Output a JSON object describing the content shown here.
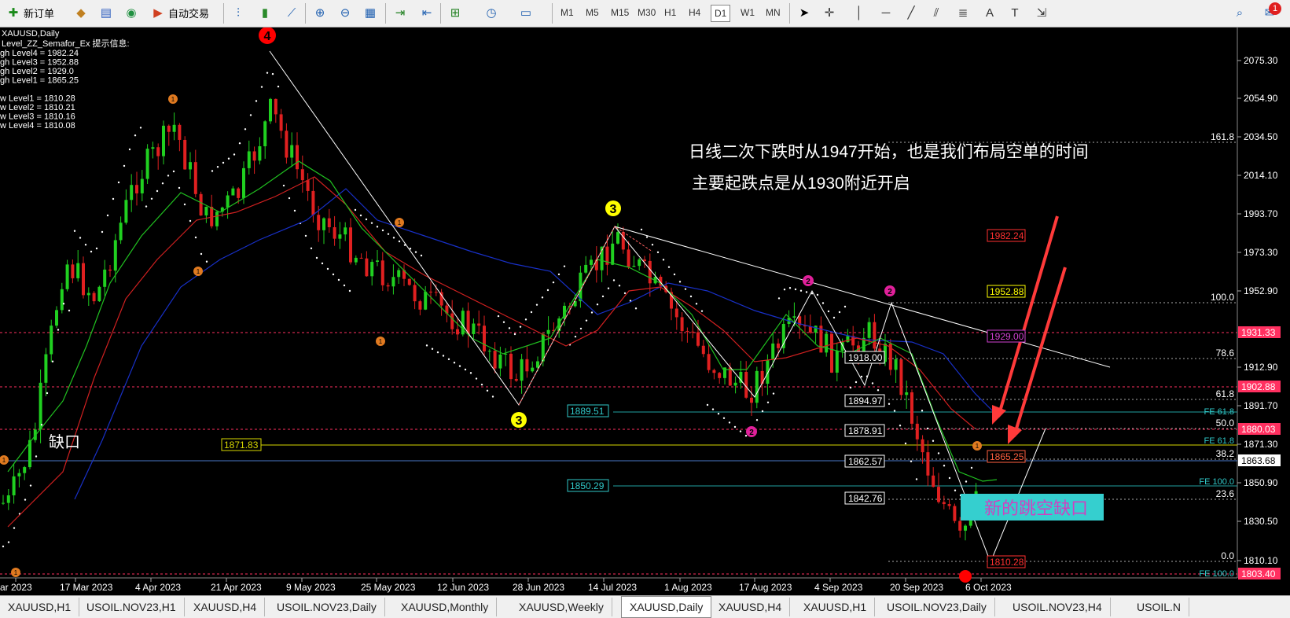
{
  "toolbar": {
    "new_order": "新订单",
    "autotrade": "自动交易",
    "timeframes": [
      "M1",
      "M5",
      "M15",
      "M30",
      "H1",
      "H4",
      "D1",
      "W1",
      "MN"
    ],
    "active_timeframe": "D1",
    "notification_count": "1"
  },
  "chart": {
    "symbol_line": "XAUUSD,Daily",
    "indicator_title": "Level_ZZ_Semafor_Ex 提示信息:",
    "levels_text": [
      "gh Level4 = 1982.24",
      "gh Level3 = 1952.88",
      "gh Level2 = 1929.0",
      "gh Level1 = 1865.25",
      "",
      "w Level1 = 1810.28",
      "w Level2 = 1810.21",
      "w Level3 = 1810.16",
      "w Level4 = 1810.08"
    ],
    "annotation_1": "日线二次下跌时从1947开始，也是我们布局空单的时间",
    "annotation_2": "主要起跌点是从1930附近开启",
    "gap_label": "缺口",
    "new_gap_label": "新的跳空缺口",
    "y_ticks": [
      "2075.30",
      "2054.90",
      "2034.50",
      "2014.10",
      "1993.70",
      "1973.30",
      "1952.90",
      "1912.90",
      "1891.70",
      "1871.30",
      "1850.90",
      "1830.50",
      "1810.10"
    ],
    "price_tags": [
      {
        "text": "1931.33",
        "color": "#ff3060"
      },
      {
        "text": "1902.88",
        "color": "#ff3060"
      },
      {
        "text": "1880.03",
        "color": "#ff3060"
      },
      {
        "text": "1863.68",
        "color": "#ffffff"
      },
      {
        "text": "1803.40",
        "color": "#ff3060"
      }
    ],
    "fib_labels": [
      "161.8",
      "100.0",
      "78.6",
      "61.8",
      "50.0",
      "38.2",
      "23.6",
      "0.0"
    ],
    "fe_labels": [
      "FE 61.8",
      "FE 61.8",
      "FE 100.0",
      "FE 100.0"
    ],
    "x_ticks": [
      "ar 2023",
      "17 Mar 2023",
      "4 Apr 2023",
      "21 Apr 2023",
      "9 May 2023",
      "25 May 2023",
      "12 Jun 2023",
      "28 Jun 2023",
      "14 Jul 2023",
      "1 Aug 2023",
      "17 Aug 2023",
      "4 Sep 2023",
      "20 Sep 2023",
      "6 Oct 2023"
    ],
    "boxed_prices": [
      "1918.00",
      "1894.97",
      "1878.91",
      "1862.57",
      "1842.76"
    ],
    "cyan_boxes": [
      "1889.51",
      "1850.29"
    ],
    "yellow_box": "1871.83",
    "level_tags": [
      {
        "text": "1982.24",
        "color": "#ff3030"
      },
      {
        "text": "1952.88",
        "color": "#ffff00"
      },
      {
        "text": "1929.00",
        "color": "#d040d0"
      },
      {
        "text": "1865.25",
        "color": "#ff6040"
      },
      {
        "text": "1810.28",
        "color": "#ff3030"
      }
    ],
    "semafor_marks": [
      {
        "label": "4",
        "color": "#ff0000"
      },
      {
        "label": "3",
        "color": "#ffff00"
      },
      {
        "label": "3",
        "color": "#ffff00"
      },
      {
        "label": "2",
        "color": "#e0209a"
      },
      {
        "label": "2",
        "color": "#e0209a"
      },
      {
        "label": "2",
        "color": "#e0209a"
      },
      {
        "label": "1",
        "color": "#e07a20"
      }
    ]
  },
  "tabs": [
    "XAUUSD,H1",
    "USOIL.NOV23,H1",
    "XAUUSD,H4",
    "USOIL.NOV23,Daily",
    "XAUUSD,Monthly",
    "XAUUSD,Weekly",
    "XAUUSD,Daily",
    "XAUUSD,H4",
    "XAUUSD,H1",
    "USOIL.NOV23,Daily",
    "USOIL.NOV23,H4",
    "USOIL.N"
  ],
  "active_tab": "XAUUSD,Daily"
}
